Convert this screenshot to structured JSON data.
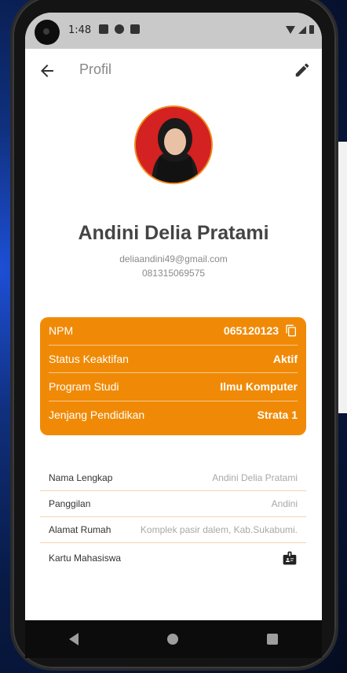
{
  "status_bar": {
    "time": "1:48"
  },
  "appbar": {
    "title": "Profil"
  },
  "profile": {
    "name": "Andini Delia Pratami",
    "email": "deliaandini49@gmail.com",
    "phone": "081315069575"
  },
  "academic": [
    {
      "label": "NPM",
      "value": "065120123"
    },
    {
      "label": "Status Keaktifan",
      "value": "Aktif"
    },
    {
      "label": "Program Studi",
      "value": "Ilmu Komputer"
    },
    {
      "label": "Jenjang Pendidikan",
      "value": "Strata 1"
    }
  ],
  "details": [
    {
      "label": "Nama Lengkap",
      "value": "Andini Delia Pratami"
    },
    {
      "label": "Panggilan",
      "value": "Andini"
    },
    {
      "label": "Alamat Rumah",
      "value": "Komplek pasir dalem, Kab.Sukabumi."
    },
    {
      "label": "Kartu Mahasiswa"
    }
  ],
  "colors": {
    "accent": "#f08a06",
    "divider": "#f6d3ad"
  },
  "icons": [
    "back-arrow-icon",
    "edit-pencil-icon",
    "copy-icon",
    "id-card-icon"
  ]
}
